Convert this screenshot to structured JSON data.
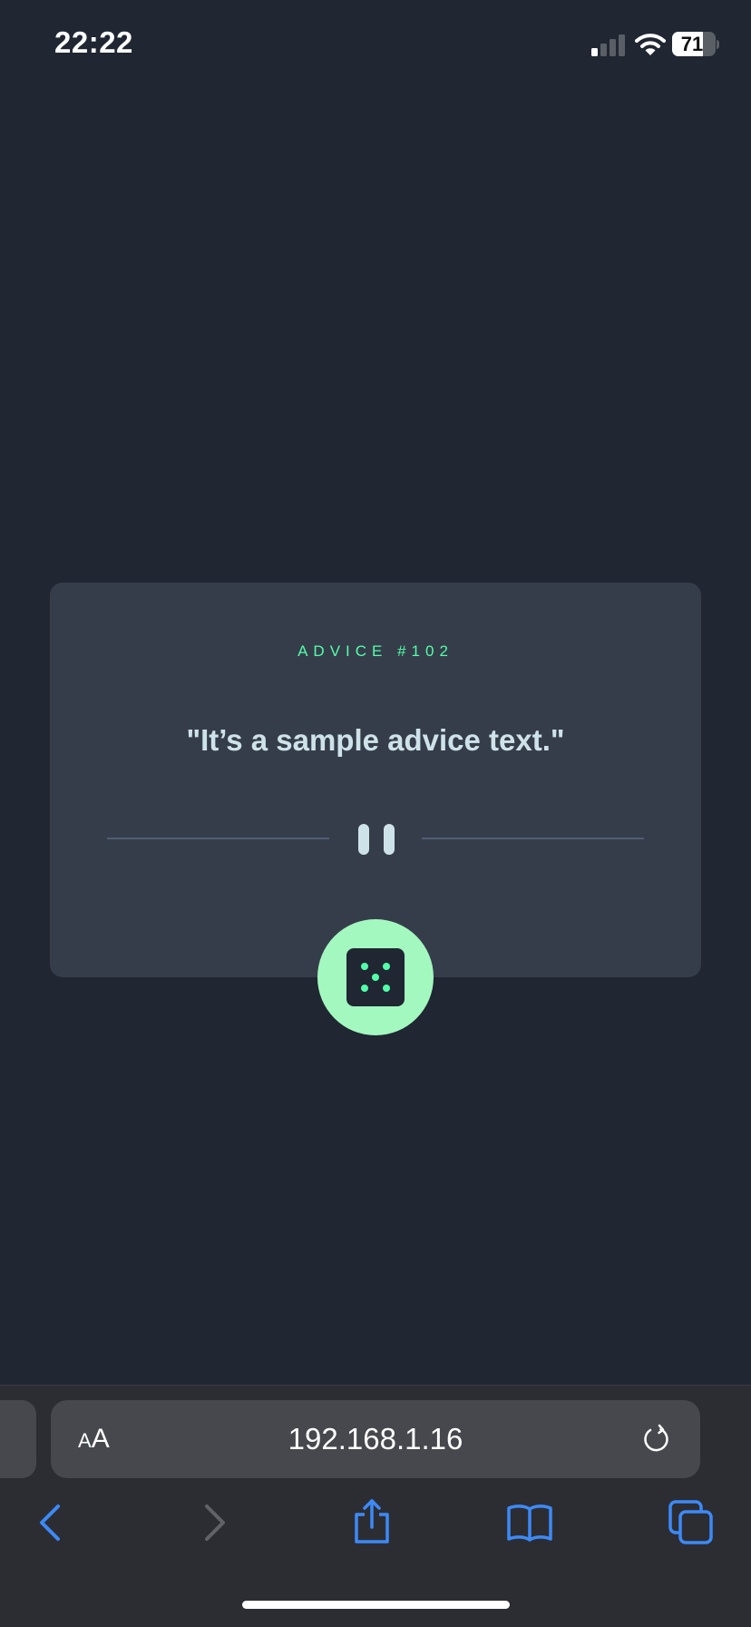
{
  "status_bar": {
    "time": "22:22",
    "battery_percent": "71",
    "battery_level": 0.71,
    "signal_bars_active": 1,
    "signal_bars_total": 4,
    "icons": [
      "signal-icon",
      "wifi-icon",
      "battery-icon"
    ]
  },
  "advice": {
    "label": "ADVICE #102",
    "quote": "\"It’s a sample advice text.\"",
    "divider_icon": "pause-icon",
    "button_icon": "dice-icon"
  },
  "browser": {
    "text_size_small": "A",
    "text_size_large": "A",
    "url": "192.168.1.16",
    "reload_icon": "reload-icon",
    "toolbar": [
      "back-icon",
      "forward-icon",
      "share-icon",
      "bookmarks-icon",
      "tabs-icon"
    ]
  },
  "colors": {
    "background": "#202632",
    "card": "#363d4a",
    "accent_green": "#52ffa8",
    "button_green": "#a3f8c0",
    "quote_text": "#cee3e9",
    "divider": "#4f5d74",
    "safari_blue": "#3d8af7",
    "chrome_bg": "#2c2d33",
    "address_bar": "#47484e"
  }
}
